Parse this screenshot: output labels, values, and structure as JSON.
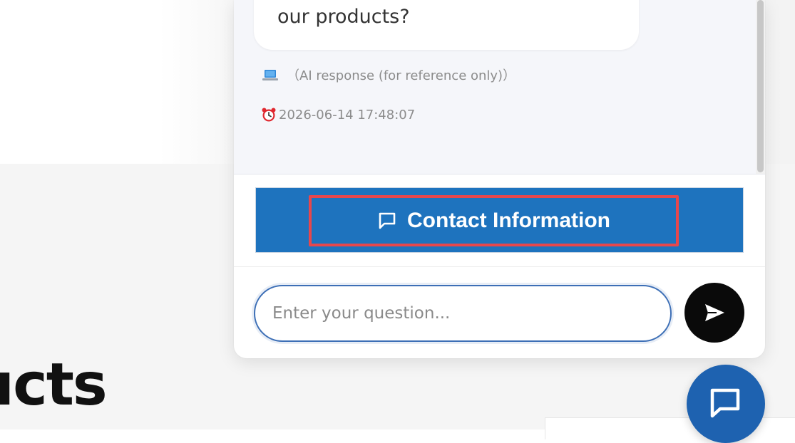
{
  "page": {
    "heading": "ıcts"
  },
  "chat": {
    "bot_message_tail": "our products?",
    "ai_note": "（AI response (for reference only)）",
    "timestamp": "2026-06-14 17:48:07",
    "contact_button_label": "Contact Information",
    "input": {
      "placeholder": "Enter your question...",
      "value": ""
    }
  },
  "icons": {
    "ai_note": "laptop-icon",
    "timestamp": "alarm-clock-icon",
    "contact": "message-square-icon",
    "send": "send-arrow-icon",
    "launcher": "chat-bubble-icon"
  },
  "colors": {
    "contact_bar": "#1e73be",
    "highlight_border": "#e8474c",
    "send_button": "#0a0a0a",
    "launcher": "#1e62b0",
    "input_border": "#3d6fb6"
  }
}
